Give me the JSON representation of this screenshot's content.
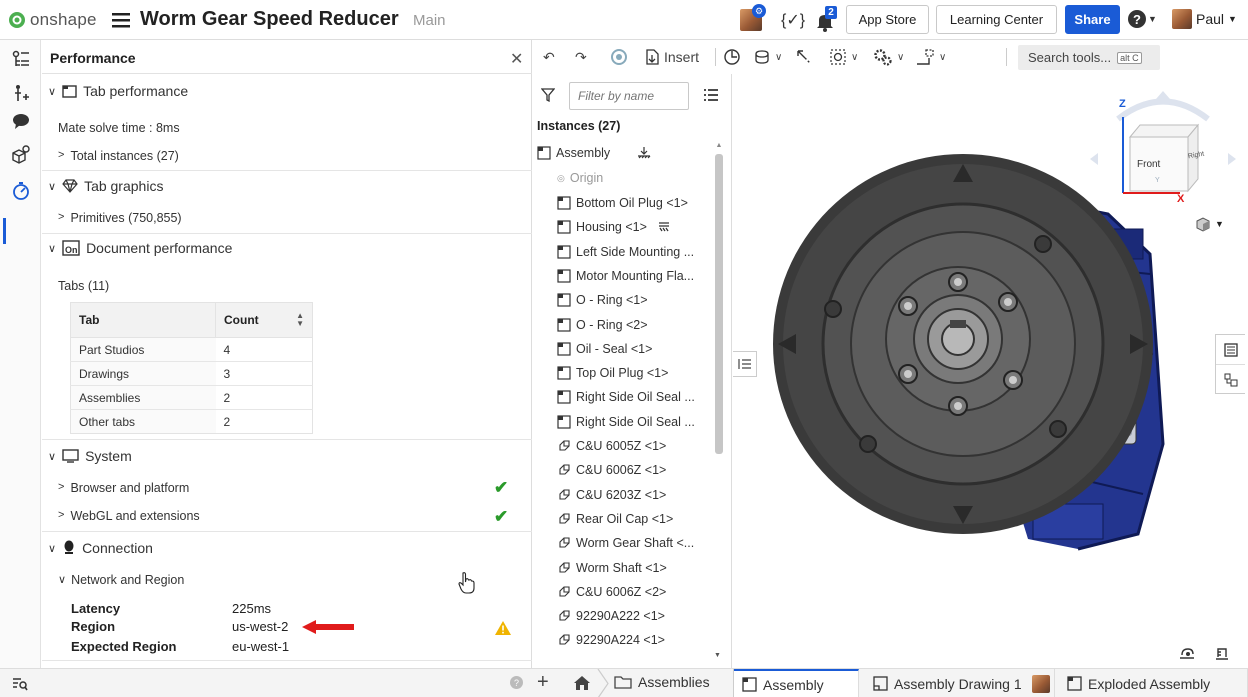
{
  "app": {
    "logo_text": "onshape",
    "document_title": "Worm Gear Speed Reducer",
    "branch": "Main"
  },
  "header": {
    "notification_count": "2",
    "variable_label": "{✓}",
    "app_store": "App Store",
    "learning_center": "Learning Center",
    "share": "Share",
    "help": "?",
    "user": "Paul"
  },
  "performance": {
    "title": "Performance",
    "tab_performance": {
      "label": "Tab performance",
      "mate_solve": "Mate solve time : 8ms",
      "total_instances": "Total instances (27)"
    },
    "tab_graphics": {
      "label": "Tab graphics",
      "primitives": "Primitives (750,855)"
    },
    "document_performance": {
      "label": "Document performance",
      "tabs_count": "Tabs (11)",
      "table": {
        "headers": [
          "Tab",
          "Count"
        ],
        "rows": [
          [
            "Part Studios",
            "4"
          ],
          [
            "Drawings",
            "3"
          ],
          [
            "Assemblies",
            "2"
          ],
          [
            "Other tabs",
            "2"
          ]
        ]
      }
    },
    "system": {
      "label": "System",
      "browser": "Browser and platform",
      "webgl": "WebGL and extensions"
    },
    "connection": {
      "label": "Connection",
      "network": "Network and Region",
      "latency_label": "Latency",
      "latency_value": "225ms",
      "region_label": "Region",
      "region_value": "us-west-2",
      "expected_label": "Expected Region",
      "expected_value": "eu-west-1"
    }
  },
  "toolbar": {
    "insert": "Insert",
    "search_tools": "Search tools...",
    "shortcut": "alt C"
  },
  "instances": {
    "filter_placeholder": "Filter by name",
    "title": "Instances (27)",
    "items": [
      "Assembly",
      "Origin",
      "Bottom Oil Plug <1>",
      "Housing <1>",
      "Left Side Mounting ...",
      "Motor Mounting Fla...",
      "O - Ring <1>",
      "O - Ring <2>",
      "Oil - Seal <1>",
      "Top Oil Plug <1>",
      "Right Side Oil Seal ...",
      "Right Side Oil Seal ...",
      "C&U 6005Z <1>",
      "C&U 6006Z <1>",
      "C&U 6203Z <1>",
      "Rear Oil Cap <1>",
      "Worm Gear Shaft <...",
      "Worm Shaft <1>",
      "C&U 6006Z <2>",
      "92290A222 <1>",
      "92290A224 <1>"
    ]
  },
  "viewcube": {
    "front": "Front",
    "right": "Right",
    "axis_z": "Z",
    "axis_x": "X",
    "axis_y": "Y"
  },
  "bottom_tabs": {
    "assemblies_folder": "Assemblies",
    "tab1": "Assembly",
    "tab2": "Assembly Drawing 1",
    "tab3": "Exploded Assembly"
  },
  "colors": {
    "accent": "#1a5bd6",
    "housing_blue": "#23358f",
    "flange_gray": "#4a4a4a",
    "warning": "#f0b400",
    "ok_green": "#2a9a2a",
    "arrow_red": "#e01b1b"
  }
}
